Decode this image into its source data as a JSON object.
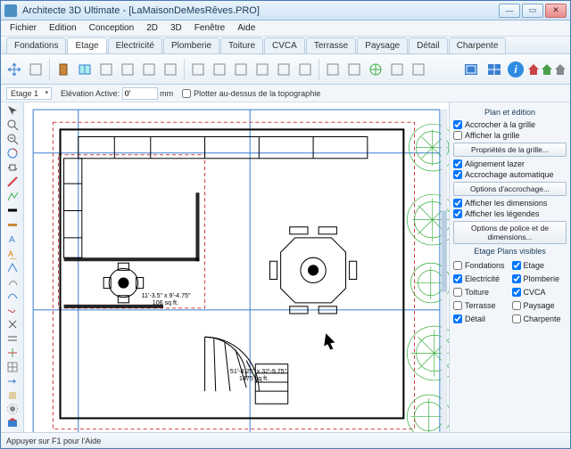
{
  "window": {
    "title": "Architecte 3D Ultimate - [LaMaisonDeMesRêves.PRO]"
  },
  "menubar": [
    "Fichier",
    "Edition",
    "Conception",
    "2D",
    "3D",
    "Fenêtre",
    "Aide"
  ],
  "tabs": {
    "items": [
      "Fondations",
      "Etage",
      "Electricité",
      "Plomberie",
      "Toiture",
      "CVCA",
      "Terrasse",
      "Paysage",
      "Détail",
      "Charpente"
    ],
    "active": 1
  },
  "subbar": {
    "floor_dd": "Etage 1",
    "elev_label": "Elévation Active:",
    "elev_value": "0'",
    "elev_unit": "mm",
    "plot_label": "Plotter au-dessus de la topographie"
  },
  "toolbar_icons": [
    "arrow-cross-icon",
    "nav-icon",
    "door-icon",
    "window-icon",
    "window2-icon",
    "book-icon",
    "opening-icon",
    "bifold-icon",
    "shape-icon",
    "curve-icon",
    "rect-fill-icon",
    "rect-fill2-icon",
    "rect-line-icon",
    "circle-icon",
    "wall-icon",
    "wall-layer-icon",
    "plant-icon",
    "pattern1-icon",
    "pattern2-icon"
  ],
  "left_tools": [
    "select-icon",
    "zoom-icon",
    "zoom-out-icon",
    "orbit-icon",
    "pan-icon",
    "line-icon",
    "polyline-icon",
    "wall-icon",
    "tape-icon",
    "text-icon",
    "dim-icon",
    "angle-icon",
    "fillet-icon",
    "spline-icon",
    "curve2-icon",
    "perp-icon",
    "parallel-icon",
    "axis-icon",
    "grid-icon",
    "extend-icon",
    "fill-icon",
    "settings-icon",
    "3d-icon"
  ],
  "right_panel": {
    "section1_title": "Plan et édition",
    "snap_grid": "Accrocher à la grille",
    "show_grid": "Afficher la grille",
    "grid_props_btn": "Propriétés de la grille...",
    "laser_align": "Alignement lazer",
    "auto_snap": "Accrochage automatique",
    "snap_opts_btn": "Options d'accrochage...",
    "show_dims": "Afficher les dimensions",
    "show_legends": "Afficher les légendes",
    "font_dim_btn": "Options de police et de dimensions...",
    "section2_title": "Etage Plans visibles",
    "plans": [
      {
        "label": "Fondations",
        "checked": false
      },
      {
        "label": "Etage",
        "checked": true
      },
      {
        "label": "Electricité",
        "checked": true
      },
      {
        "label": "Plomberie",
        "checked": true
      },
      {
        "label": "Toiture",
        "checked": false
      },
      {
        "label": "CVCA",
        "checked": true
      },
      {
        "label": "Terrasse",
        "checked": false
      },
      {
        "label": "Paysage",
        "checked": false
      },
      {
        "label": "Détail",
        "checked": true
      },
      {
        "label": "Charpente",
        "checked": false
      }
    ]
  },
  "floorplan": {
    "room1_dim": "11'-3.5\" x 9'-4.75\"",
    "room1_area": "106 sq ft.",
    "room2_dim": "51'-8.25\" x 32'-9.75\"",
    "room2_area": "1475 sq ft."
  },
  "statusbar": {
    "hint": "Appuyer sur F1 pour l'Aide"
  },
  "colors": {
    "accent": "#2e8be0",
    "wall": "#000000",
    "guide": "#3a7fd1",
    "dash": "#d14040",
    "tree": "#3cb043"
  }
}
